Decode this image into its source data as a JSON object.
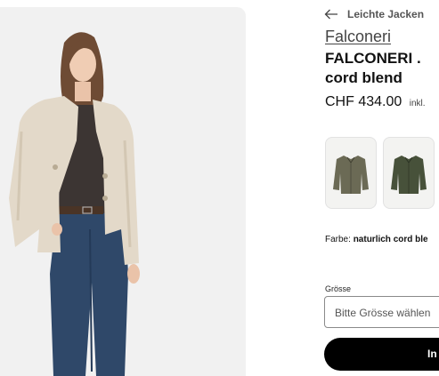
{
  "breadcrumb": {
    "back_icon": "arrow-left-icon",
    "label": "Leichte Jacken"
  },
  "product": {
    "brand": "Falconeri",
    "title_line1": "FALCONERI .",
    "title_line2": "cord blend",
    "price": "CHF 434.00",
    "price_note": "inkl."
  },
  "variants": [
    {
      "name": "thumbnail-olive-jacket",
      "color": "#6b6a55"
    },
    {
      "name": "thumbnail-green-jacket",
      "color": "#47513a"
    }
  ],
  "color_selector": {
    "label": "Farbe:",
    "value": "naturlich cord ble"
  },
  "size_selector": {
    "label": "Grösse",
    "placeholder": "Bitte Grösse wählen"
  },
  "cta": {
    "label": "In"
  },
  "colors": {
    "hero_bg": "#f1f1f1",
    "cta_bg": "#000000",
    "jacket": "#e3d9c9"
  }
}
